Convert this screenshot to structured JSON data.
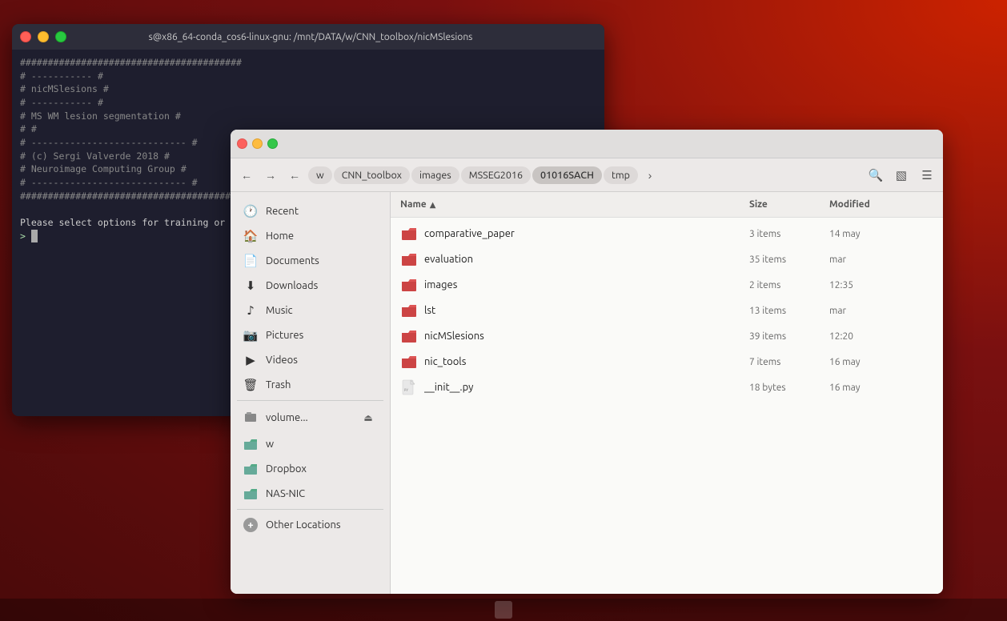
{
  "terminal": {
    "title": "s@x86_64-conda_cos6-linux-gnu: /mnt/DATA/w/CNN_toolbox/nicMSlesions",
    "lines": [
      "########################################",
      "# -----------",
      "# nicMSlesions",
      "# -----------",
      "# MS WM lesion segmentation",
      "#",
      "# ----------------------------",
      "# (c) Sergi Valverde 2018",
      "# Neuroimage Computing Group",
      "# ----------------------------",
      "########################################",
      "",
      "Please select options for training or i",
      ">"
    ]
  },
  "filemanager": {
    "breadcrumbs": [
      "w",
      "CNN_toolbox",
      "images",
      "MSSEG2016",
      "01016SACH",
      "tmp"
    ],
    "sidebar": {
      "items": [
        {
          "id": "recent",
          "label": "Recent",
          "icon": "🕐",
          "type": "nav"
        },
        {
          "id": "home",
          "label": "Home",
          "icon": "🏠",
          "type": "nav"
        },
        {
          "id": "documents",
          "label": "Documents",
          "icon": "📄",
          "type": "nav"
        },
        {
          "id": "downloads",
          "label": "Downloads",
          "icon": "⬇",
          "type": "nav"
        },
        {
          "id": "music",
          "label": "Music",
          "icon": "♪",
          "type": "nav"
        },
        {
          "id": "pictures",
          "label": "Pictures",
          "icon": "🖼",
          "type": "nav"
        },
        {
          "id": "videos",
          "label": "Videos",
          "icon": "▶",
          "type": "nav"
        },
        {
          "id": "trash",
          "label": "Trash",
          "icon": "🗑",
          "type": "nav"
        },
        {
          "id": "volume",
          "label": "volume...",
          "icon": "💾",
          "type": "device",
          "eject": true
        },
        {
          "id": "w",
          "label": "w",
          "icon": "📁",
          "type": "device"
        },
        {
          "id": "dropbox",
          "label": "Dropbox",
          "icon": "📦",
          "type": "device"
        },
        {
          "id": "nas-nic",
          "label": "NAS-NIC",
          "icon": "🖥",
          "type": "device"
        },
        {
          "id": "other",
          "label": "Other Locations",
          "icon": "+",
          "type": "other"
        }
      ]
    },
    "columns": {
      "name": "Name",
      "size": "Size",
      "modified": "Modified"
    },
    "files": [
      {
        "name": "comparative_paper",
        "type": "folder",
        "size": "3 items",
        "modified": "14 may",
        "color": "#d44"
      },
      {
        "name": "evaluation",
        "type": "folder",
        "size": "35 items",
        "modified": "mar",
        "color": "#d44"
      },
      {
        "name": "images",
        "type": "folder",
        "size": "2 items",
        "modified": "12:35",
        "color": "#d44"
      },
      {
        "name": "lst",
        "type": "folder",
        "size": "13 items",
        "modified": "mar",
        "color": "#d44"
      },
      {
        "name": "nicMSlesions",
        "type": "folder",
        "size": "39 items",
        "modified": "12:20",
        "color": "#d44"
      },
      {
        "name": "nic_tools",
        "type": "folder",
        "size": "7 items",
        "modified": "16 may",
        "color": "#d44"
      },
      {
        "name": "__init__.py",
        "type": "file",
        "size": "18 bytes",
        "modified": "16 may",
        "color": null
      }
    ]
  }
}
